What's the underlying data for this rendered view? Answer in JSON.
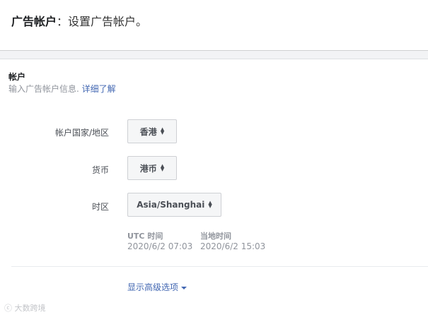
{
  "header": {
    "title_strong": "广告帐户",
    "title_rest": "：设置广告帐户。"
  },
  "account": {
    "title": "帐户",
    "subtitle": "输入广告帐户信息.",
    "learn_more": "详细了解"
  },
  "fields": {
    "country": {
      "label": "帐户国家/地区",
      "value": "香港"
    },
    "currency": {
      "label": "货币",
      "value": "港币"
    },
    "timezone": {
      "label": "时区",
      "value": "Asia/Shanghai"
    }
  },
  "time_info": {
    "utc_label": "UTC 时间",
    "utc_value": "2020/6/2 07:03",
    "local_label": "当地时间",
    "local_value": "2020/6/2 15:03"
  },
  "advanced_options": "显示高级选项",
  "watermark": "大数跨境",
  "colors": {
    "link": "#4267b2",
    "muted": "#90949c",
    "select_bg": "#f5f6f7"
  }
}
